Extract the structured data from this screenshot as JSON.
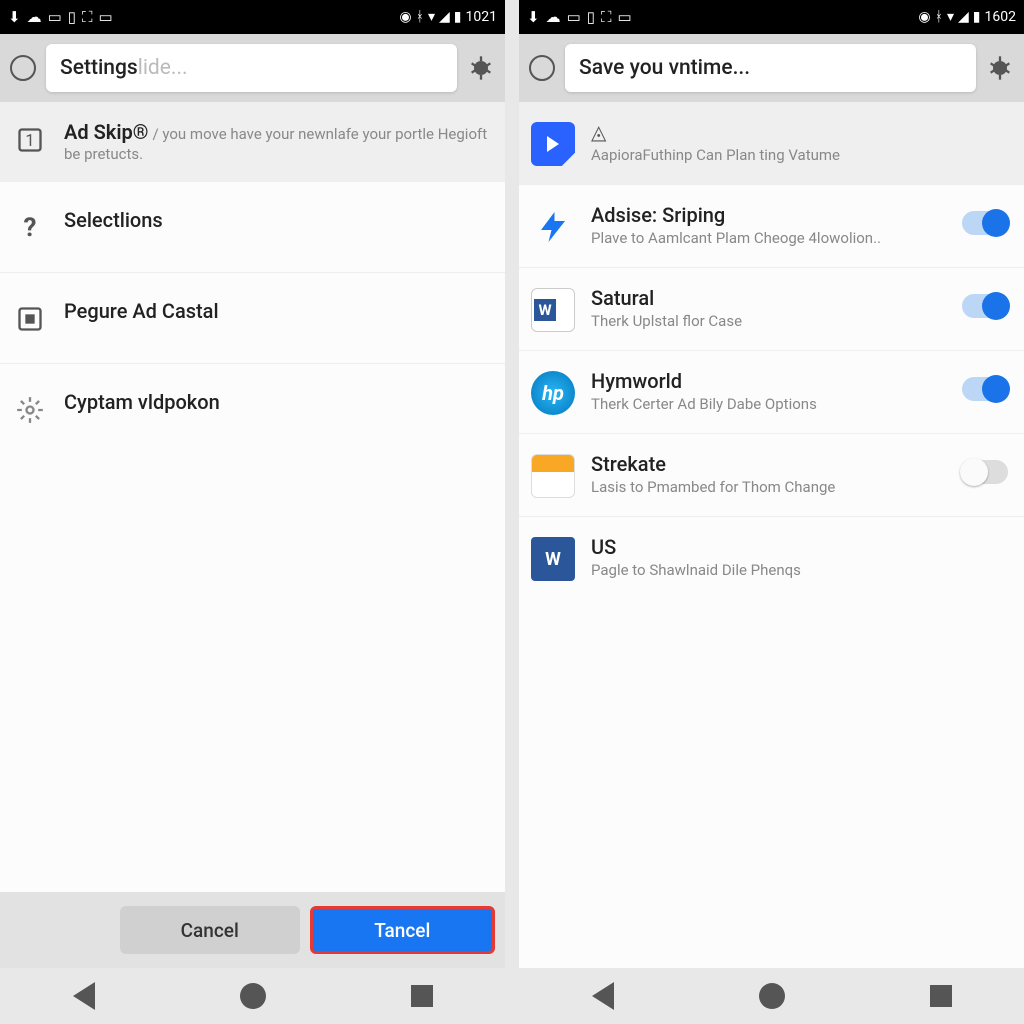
{
  "left": {
    "status": {
      "time": "1021"
    },
    "search": {
      "typed": "Settings",
      "hint": " lide..."
    },
    "rows": [
      {
        "title": "Ad Skip®",
        "sub": "/ you move have your newnlafe your portle Hegioft be pretucts."
      },
      {
        "title": "Selectlions"
      },
      {
        "title": "Pegure Ad Castal"
      },
      {
        "title": "Cyptam vldpokon"
      }
    ],
    "buttons": {
      "cancel": "Cancel",
      "confirm": "Tancel"
    }
  },
  "right": {
    "status": {
      "time": "1602"
    },
    "search": {
      "typed": "Save you vntime..."
    },
    "rows": [
      {
        "title": "",
        "sub": "AapioraFuthinp Can Plan ting Vatume",
        "toggle": null,
        "icon": "play",
        "tri": "◬"
      },
      {
        "title": "Adsise: Sriping",
        "sub": "Plave to Aamlcant Plam Cheoge 4lowolion..",
        "toggle": true,
        "icon": "bolt"
      },
      {
        "title": "Satural",
        "sub": "Therk Uplstal flor Case",
        "toggle": true,
        "icon": "word"
      },
      {
        "title": "Hymworld",
        "sub": "Therk Certer Ad Bily Dabe Options",
        "toggle": true,
        "icon": "hp"
      },
      {
        "title": "Strekate",
        "sub": "Lasis to Pmambed for Thom Change",
        "toggle": false,
        "icon": "cal"
      },
      {
        "title": "US",
        "sub": "Pagle to Shawlnaid Dile Phenqs",
        "toggle": null,
        "icon": "word2"
      }
    ]
  }
}
